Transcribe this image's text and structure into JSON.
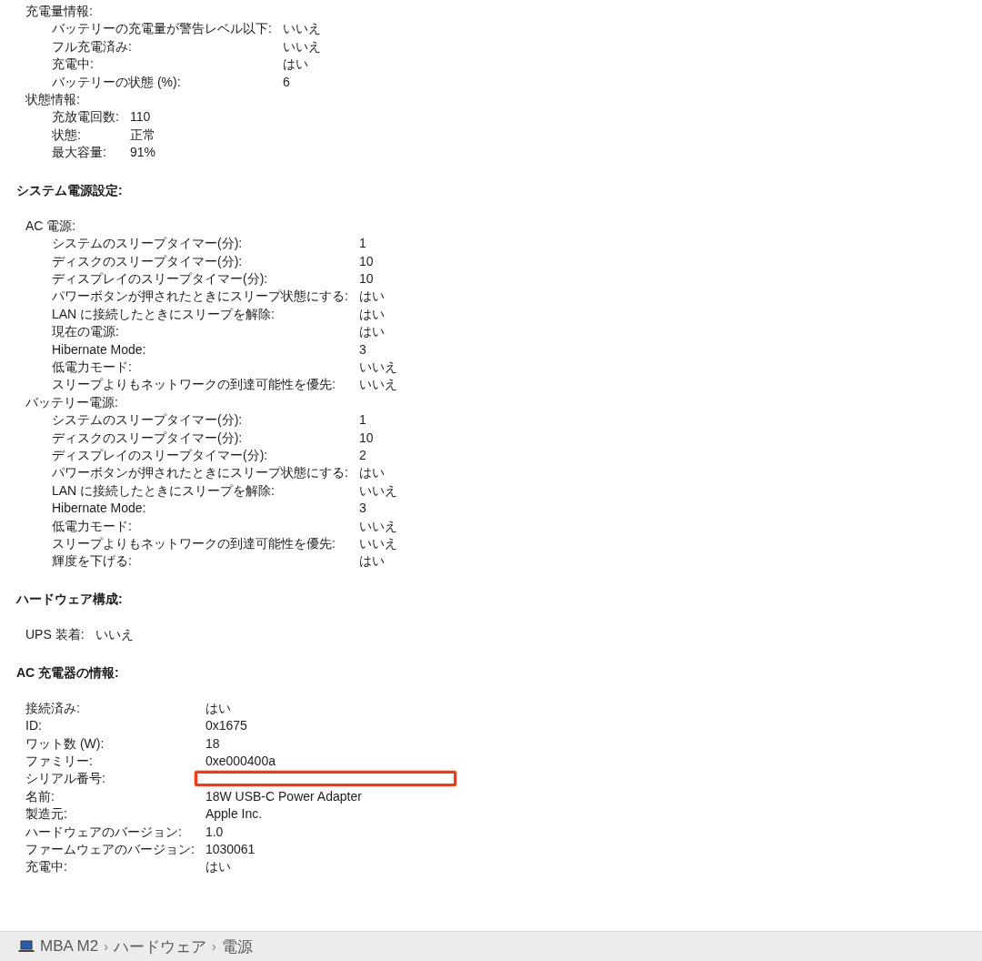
{
  "blocks": [
    {
      "kind": "group",
      "title": "充電量情報:",
      "rows": [
        {
          "label": "バッテリーの充電量が警告レベル以下:",
          "value": "いいえ"
        },
        {
          "label": "フル充電済み:",
          "value": "いいえ"
        },
        {
          "label": "充電中:",
          "value": "はい"
        },
        {
          "label": "バッテリーの状態 (%):",
          "value": "6"
        }
      ]
    },
    {
      "kind": "group",
      "title": "状態情報:",
      "rows": [
        {
          "label": "充放電回数:",
          "value": "110"
        },
        {
          "label": "状態:",
          "value": "正常"
        },
        {
          "label": "最大容量:",
          "value": "91%"
        }
      ]
    },
    {
      "kind": "heading",
      "title": "システム電源設定:"
    },
    {
      "kind": "group",
      "title": "AC 電源:",
      "rows": [
        {
          "label": "システムのスリープタイマー(分):",
          "value": "1"
        },
        {
          "label": "ディスクのスリープタイマー(分):",
          "value": "10"
        },
        {
          "label": "ディスプレイのスリープタイマー(分):",
          "value": "10"
        },
        {
          "label": "パワーボタンが押されたときにスリープ状態にする:",
          "value": "はい"
        },
        {
          "label": "LAN に接続したときにスリープを解除:",
          "value": "はい"
        },
        {
          "label": "現在の電源:",
          "value": "はい"
        },
        {
          "label": "Hibernate Mode:",
          "value": "3"
        },
        {
          "label": "低電力モード:",
          "value": "いいえ"
        },
        {
          "label": "スリープよりもネットワークの到達可能性を優先:",
          "value": "いいえ"
        }
      ]
    },
    {
      "kind": "group",
      "title": "バッテリー電源:",
      "rows": [
        {
          "label": "システムのスリープタイマー(分):",
          "value": "1"
        },
        {
          "label": "ディスクのスリープタイマー(分):",
          "value": "10"
        },
        {
          "label": "ディスプレイのスリープタイマー(分):",
          "value": "2"
        },
        {
          "label": "パワーボタンが押されたときにスリープ状態にする:",
          "value": "はい"
        },
        {
          "label": "LAN に接続したときにスリープを解除:",
          "value": "いいえ"
        },
        {
          "label": "Hibernate Mode:",
          "value": "3"
        },
        {
          "label": "低電力モード:",
          "value": "いいえ"
        },
        {
          "label": "スリープよりもネットワークの到達可能性を優先:",
          "value": "いいえ"
        },
        {
          "label": "輝度を下げる:",
          "value": "はい"
        }
      ]
    },
    {
      "kind": "heading",
      "title": "ハードウェア構成:"
    },
    {
      "kind": "table",
      "rows": [
        {
          "label": "UPS 装着:",
          "value": "いいえ"
        }
      ]
    },
    {
      "kind": "heading",
      "title": "AC 充電器の情報:"
    },
    {
      "kind": "table",
      "rows": [
        {
          "label": "接続済み:",
          "value": "はい"
        },
        {
          "label": "ID:",
          "value": "0x1675"
        },
        {
          "label": "ワット数 (W):",
          "value": "18"
        },
        {
          "label": "ファミリー:",
          "value": "0xe000400a"
        },
        {
          "label": "シリアル番号:",
          "redacted": true
        },
        {
          "label": "名前:",
          "value": "18W USB-C Power Adapter"
        },
        {
          "label": "製造元:",
          "value": "Apple Inc."
        },
        {
          "label": "ハードウェアのバージョン:",
          "value": "1.0"
        },
        {
          "label": "ファームウェアのバージョン:",
          "value": "1030061"
        },
        {
          "label": "充電中:",
          "value": "はい"
        }
      ]
    }
  ],
  "status_bar": {
    "path": [
      "MBA M2",
      "ハードウェア",
      "電源"
    ],
    "separators": [
      "›",
      "›"
    ]
  }
}
